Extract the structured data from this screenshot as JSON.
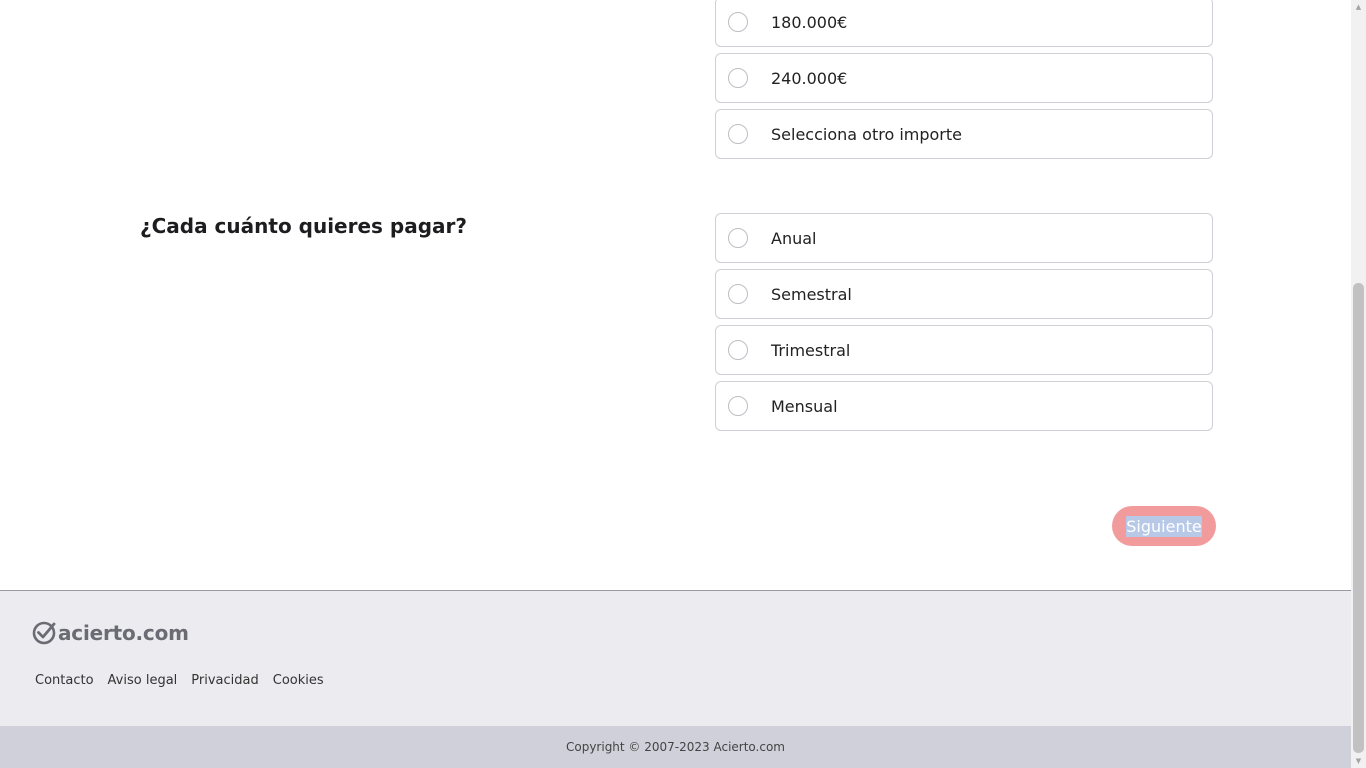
{
  "amount_options": [
    {
      "label": "180.000€"
    },
    {
      "label": "240.000€"
    },
    {
      "label": "Selecciona otro importe"
    }
  ],
  "payment": {
    "question": "¿Cada cuánto quieres pagar?",
    "options": [
      {
        "label": "Anual"
      },
      {
        "label": "Semestral"
      },
      {
        "label": "Trimestral"
      },
      {
        "label": "Mensual"
      }
    ]
  },
  "actions": {
    "next_label": "Siguiente",
    "next_color": "#f19b9c"
  },
  "footer": {
    "logo_text": "acierto.com",
    "logo_icon": "check-circle-icon",
    "links": [
      "Contacto",
      "Aviso legal",
      "Privacidad",
      "Cookies"
    ],
    "copyright": "Copyright © 2007-2023 Acierto.com"
  },
  "scrollbar": {
    "up_arrow": "▲",
    "down_arrow": "▼"
  }
}
